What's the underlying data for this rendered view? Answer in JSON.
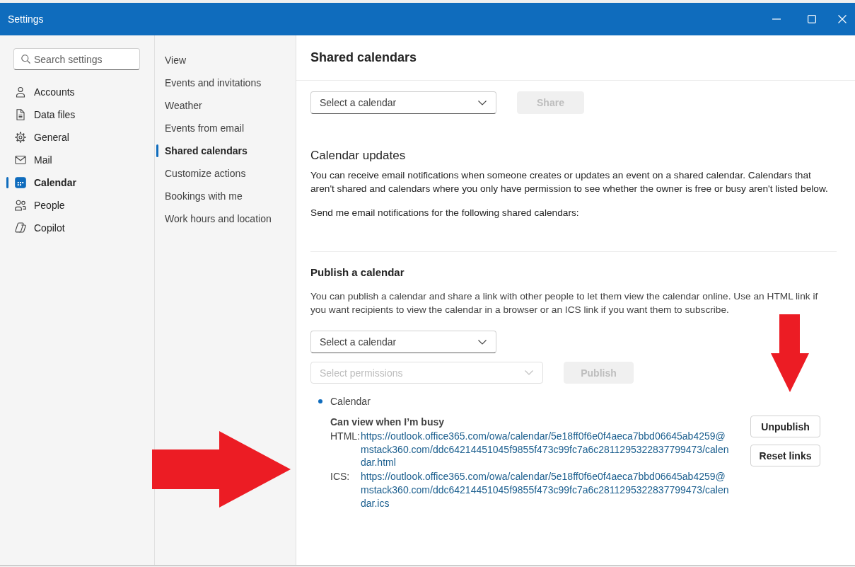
{
  "window": {
    "title": "Settings"
  },
  "search": {
    "placeholder": "Search settings"
  },
  "sidebar": {
    "items": [
      {
        "label": "Accounts",
        "selected": false
      },
      {
        "label": "Data files",
        "selected": false
      },
      {
        "label": "General",
        "selected": false
      },
      {
        "label": "Mail",
        "selected": false
      },
      {
        "label": "Calendar",
        "selected": true
      },
      {
        "label": "People",
        "selected": false
      },
      {
        "label": "Copilot",
        "selected": false
      }
    ]
  },
  "subnav": {
    "items": [
      {
        "label": "View",
        "selected": false
      },
      {
        "label": "Events and invitations",
        "selected": false
      },
      {
        "label": "Weather",
        "selected": false
      },
      {
        "label": "Events from email",
        "selected": false
      },
      {
        "label": "Shared calendars",
        "selected": true
      },
      {
        "label": "Customize actions",
        "selected": false
      },
      {
        "label": "Bookings with me",
        "selected": false
      },
      {
        "label": "Work hours and location",
        "selected": false
      }
    ]
  },
  "main": {
    "title": "Shared calendars",
    "share": {
      "select": {
        "placeholder": "Select a calendar",
        "disabled": false
      },
      "button": {
        "label": "Share",
        "disabled": true
      }
    },
    "updates": {
      "heading": "Calendar updates",
      "description": "You can receive email notifications when someone creates or updates an event on a shared calendar. Calendars that aren't shared and calendars where you only have permission to see whether the owner is free or busy aren't listed below.",
      "prompt": "Send me email notifications for the following shared calendars:"
    },
    "publish": {
      "heading": "Publish a calendar",
      "description": "You can publish a calendar and share a link with other people to let them view the calendar online. Use an HTML link if you want recipients to view the calendar in a browser or an ICS link if you want them to subscribe.",
      "calendar_select": {
        "placeholder": "Select a calendar",
        "disabled": false
      },
      "permissions_select": {
        "placeholder": "Select permissions",
        "disabled": true
      },
      "button": {
        "label": "Publish",
        "disabled": true
      },
      "published": [
        {
          "name": "Calendar",
          "permission": "Can view when I’m busy",
          "links": [
            {
              "label": "HTML:",
              "url": "https://outlook.office365.com/owa/calendar/5e18ff0f6e0f4aeca7bbd06645ab4259@mstack360.com/ddc64214451045f9855f473c99fc7a6c2811295322837799473/calendar.html"
            },
            {
              "label": "ICS:",
              "url": "https://outlook.office365.com/owa/calendar/5e18ff0f6e0f4aeca7bbd06645ab4259@mstack360.com/ddc64214451045f9855f473c99fc7a6c2811295322837799473/calendar.ics"
            }
          ],
          "buttons": [
            {
              "label": "Unpublish",
              "disabled": false
            },
            {
              "label": "Reset links",
              "disabled": false
            }
          ]
        }
      ]
    }
  },
  "annotations": [
    {
      "kind": "arrow-down"
    },
    {
      "kind": "arrow-right"
    }
  ]
}
